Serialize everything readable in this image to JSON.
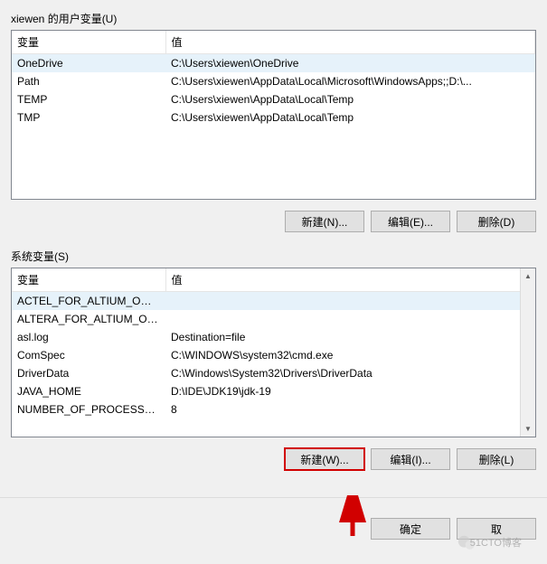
{
  "user_section": {
    "label": "xiewen 的用户变量(U)",
    "headers": {
      "name": "变量",
      "value": "值"
    },
    "rows": [
      {
        "name": "OneDrive",
        "value": "C:\\Users\\xiewen\\OneDrive"
      },
      {
        "name": "Path",
        "value": "C:\\Users\\xiewen\\AppData\\Local\\Microsoft\\WindowsApps;;D:\\..."
      },
      {
        "name": "TEMP",
        "value": "C:\\Users\\xiewen\\AppData\\Local\\Temp"
      },
      {
        "name": "TMP",
        "value": "C:\\Users\\xiewen\\AppData\\Local\\Temp"
      }
    ],
    "buttons": {
      "new": "新建(N)...",
      "edit": "编辑(E)...",
      "delete": "删除(D)"
    }
  },
  "system_section": {
    "label": "系统变量(S)",
    "headers": {
      "name": "变量",
      "value": "值"
    },
    "rows": [
      {
        "name": "ACTEL_FOR_ALTIUM_OVE...",
        "value": ""
      },
      {
        "name": "ALTERA_FOR_ALTIUM_OV...",
        "value": ""
      },
      {
        "name": "asl.log",
        "value": "Destination=file"
      },
      {
        "name": "ComSpec",
        "value": "C:\\WINDOWS\\system32\\cmd.exe"
      },
      {
        "name": "DriverData",
        "value": "C:\\Windows\\System32\\Drivers\\DriverData"
      },
      {
        "name": "JAVA_HOME",
        "value": "D:\\IDE\\JDK19\\jdk-19"
      },
      {
        "name": "NUMBER_OF_PROCESSORS",
        "value": "8"
      }
    ],
    "buttons": {
      "new": "新建(W)...",
      "edit": "编辑(I)...",
      "delete": "删除(L)"
    }
  },
  "footer": {
    "ok": "确定",
    "cancel": "取"
  },
  "watermark": "51CTO博客",
  "colors": {
    "highlight_border": "#d10000",
    "selected_row": "#e6f2fa"
  }
}
